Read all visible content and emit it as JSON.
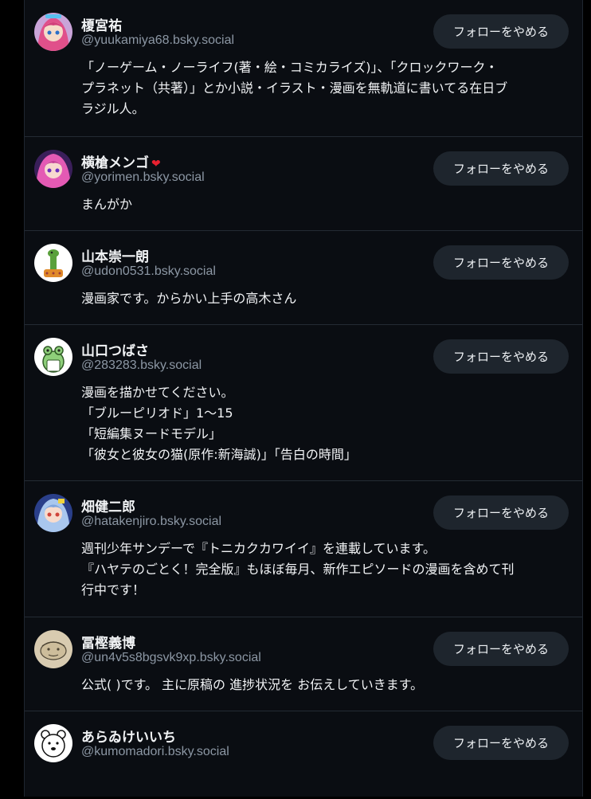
{
  "follows": [
    {
      "name": "榎宮祐",
      "handle": "@yuukamiya68.bsky.social",
      "bio": [
        "「ノーゲーム・ノーライフ(著・絵・コミカライズ)」、「クロックワーク・",
        "プラネット（共著）」とか小説・イラスト・漫画を無軌道に書いてる在日ブ",
        "ラジル人。"
      ],
      "button": "フォローをやめる",
      "avatar": "anime-girl-avatar"
    },
    {
      "name": "横槍メンゴ",
      "badge": "❤",
      "handle": "@yorimen.bsky.social",
      "bio": [
        "まんがか"
      ],
      "button": "フォローをやめる",
      "avatar": "anime-girl-avatar"
    },
    {
      "name": "山本崇一朗",
      "handle": "@udon0531.bsky.social",
      "bio": [
        "漫画家です。からかい上手の高木さん"
      ],
      "button": "フォローをやめる",
      "avatar": "giraffe-avatar"
    },
    {
      "name": "山口つばさ",
      "handle": "@283283.bsky.social",
      "bio": [
        "漫画を描かせてください。",
        "「ブルーピリオド」1〜15",
        "「短編集ヌードモデル」",
        "「彼女と彼女の猫(原作:新海誠)」「告白の時間」"
      ],
      "button": "フォローをやめる",
      "avatar": "frog-avatar"
    },
    {
      "name": "畑健二郎",
      "handle": "@hatakenjiro.bsky.social",
      "bio": [
        "週刊少年サンデーで『トニカクカワイイ』を連載しています。",
        "『ハヤテのごとく！完全版』もほぼ毎月、新作エピソードの漫画を含めて刊",
        "行中です！"
      ],
      "button": "フォローをやめる",
      "avatar": "anime-girl-avatar"
    },
    {
      "name": "冨樫義博",
      "handle": "@un4v5s8bgsvk9xp.bsky.social",
      "bio": [
        "公式( )です。 主に原稿の 進捗状況を お伝えしていきます。"
      ],
      "button": "フォローをやめる",
      "avatar": "sketch-face-avatar"
    },
    {
      "name": "あらゐけいいち",
      "handle": "@kumomadori.bsky.social",
      "bio": [],
      "button": "フォローをやめる",
      "avatar": "bear-avatar"
    }
  ],
  "colors": {
    "background": "#0a0d12",
    "button_bg": "#1e252d",
    "handle": "#8c97a4",
    "divider": "#242b34"
  }
}
